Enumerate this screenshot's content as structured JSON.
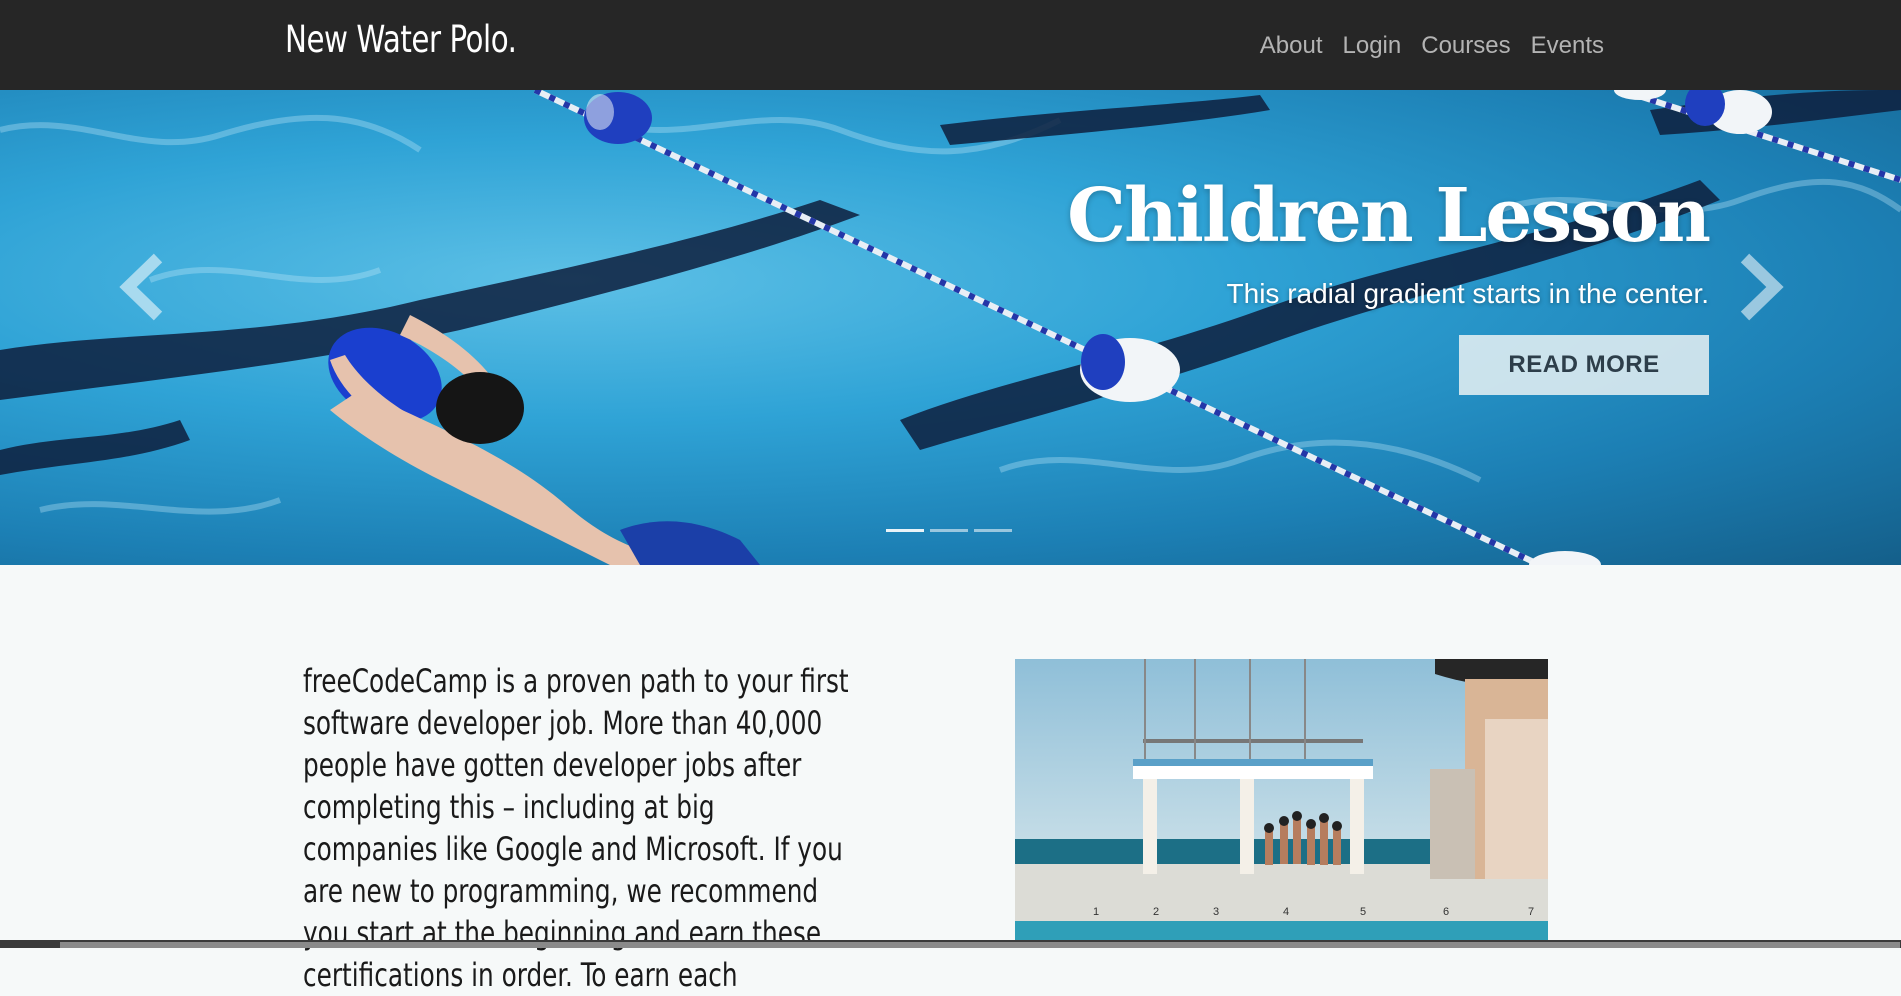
{
  "navbar": {
    "brand": "New Water Polo.",
    "links": [
      "About",
      "Login",
      "Courses",
      "Events"
    ]
  },
  "hero": {
    "title": "Children Lesson",
    "subtitle": "This radial gradient starts in the center.",
    "button_label": "READ MORE",
    "indicators_count": 3,
    "active_indicator": 0
  },
  "content": {
    "intro_text": "freeCodeCamp is a proven path to your first software developer job. More than 40,000 people have gotten developer jobs after completing this – including at big companies like Google and Microsoft. If you are new to programming, we recommend you start at the beginning and earn these certifications in order. To earn each"
  },
  "colors": {
    "navbar_bg": "#262626",
    "page_bg": "#f6f9f9",
    "pool_water": "#2fa3d6",
    "lane_float_blue": "#1f3fbf"
  }
}
